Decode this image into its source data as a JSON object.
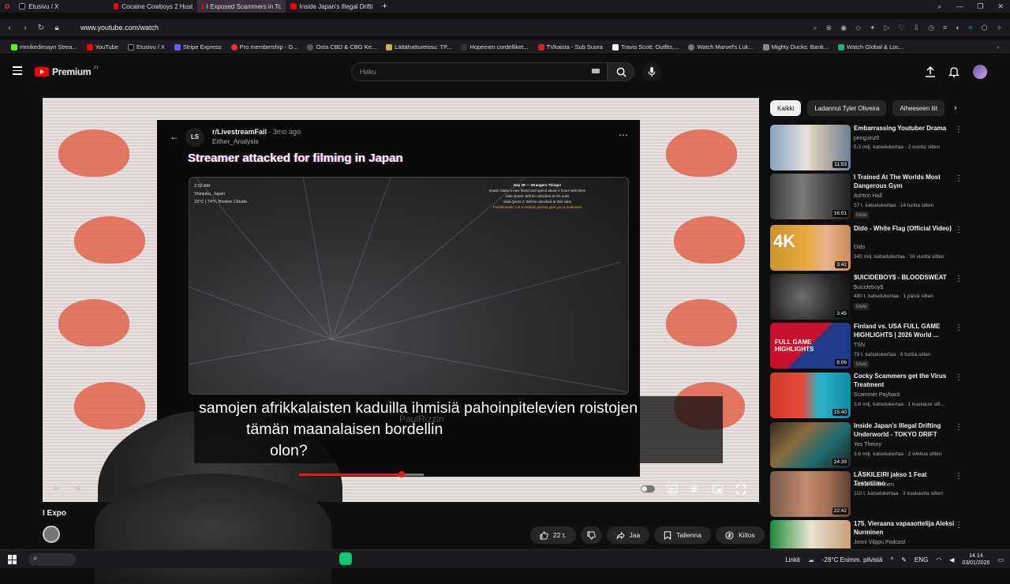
{
  "browser": {
    "tabs": [
      {
        "label": "Etusivu / X",
        "active": false
      },
      {
        "label": "Cocaine Cowboys 2 Hust",
        "active": false
      },
      {
        "label": "I Exposed Scammers in Tc",
        "active": true
      },
      {
        "label": "Inside Japan's Illegal Drifti",
        "active": false
      }
    ],
    "url": "www.youtube.com/watch",
    "bookmarks": [
      "mmikedimayn Strea...",
      "YouTube",
      "Etusivu / X",
      "Stripe Express",
      "Pro membership - G...",
      "Osta CBD & CBG Ke...",
      "Lättähattureissu: TP...",
      "Hopeinen cordelliket...",
      "TVkaista - Sub Suora",
      "Travis Scott: Outfits,...",
      "Watch Marvel's Luk...",
      "Mighty Ducks: Bank...",
      "Watch Global & Loc..."
    ]
  },
  "youtube": {
    "logo": "Premium",
    "logo_region": "FI",
    "search_placeholder": "Haku"
  },
  "player": {
    "reddit": {
      "avatar_text": "LS",
      "subreddit": "r/LivestreamFail",
      "time": " · 3mo ago",
      "user": "Either_Analysis",
      "title": "Streamer attacked for filming in Japan",
      "hud_left": [
        "2:02 AM",
        "Shinjuku, Japan",
        "23°C | 74°F, Broken Clouds"
      ],
      "hud_right": [
        "Day 29 — Strangers Things!",
        "Quest: Make a new friend and spend about 4 hours with them",
        "Side Quest: Will be unlocked at 0/1 subs",
        "Side Quest 2: Will be unlocked at 250 subs",
        "Punishments: Let a random person give you a makeover"
      ]
    },
    "subtitles": [
      "samojen afrikkalaisten kaduilla ihmisiä pahoinpitelevien roistojen",
      "tämän maanalaisen bordellin",
      "olon?"
    ],
    "ghost_text": "PaulRizzin",
    "progress_fraction": 0.82
  },
  "video": {
    "title": "I Expo",
    "actions": {
      "like": "22 t.",
      "share": "Jaa",
      "save": "Tallenna",
      "thanks": "Kiitos"
    }
  },
  "sidebar": {
    "chips": [
      "Kaikki",
      "Ladannut Tyler Oliveira",
      "Aiheeseen liit"
    ],
    "recommendations": [
      {
        "title": "Embarrassing Youtuber Drama",
        "channel": "penguinz0",
        "meta": "5,3 milj. katselukertaa · 2 vuotta sitten",
        "duration": "11:53",
        "badge": ""
      },
      {
        "title": "I Trained At The Worlds Most Dangerous Gym",
        "channel": "Ashton Hall",
        "meta": "57 t. katselukertaa · 14 tuntia sitten",
        "duration": "16:01",
        "badge": "Uusi"
      },
      {
        "title": "Dido - White Flag (Official Video)",
        "channel": "Dido",
        "meta": "340 milj. katselukertaa · 16 vuotta sitten",
        "duration": "3:42",
        "badge": ""
      },
      {
        "title": "$UICIDEBOY$ - BLOODSWEAT",
        "channel": "$uicideboy$",
        "meta": "480 t. katselukertaa · 1 päivä sitten",
        "duration": "3:45",
        "badge": "Uusi"
      },
      {
        "title": "Finland vs. USA FULL GAME HIGHLIGHTS | 2026 World ...",
        "channel": "TSN",
        "meta": "79 t. katselukertaa · 8 tuntia sitten",
        "duration": "8:06",
        "badge": "Uusi"
      },
      {
        "title": "Cocky Scammers get the Virus Treatment",
        "channel": "Scammer Payback",
        "meta": "3,8 milj. katselukertaa · 1 kuukausi sitt...",
        "duration": "15:40",
        "badge": ""
      },
      {
        "title": "Inside Japan's Illegal Drifting Underworld - TOKYO DRIFT",
        "channel": "Yes Theory",
        "meta": "3,6 milj. katselukertaa · 2 viikkoa sitten",
        "duration": "24:39",
        "badge": ""
      },
      {
        "title": "LÄSKILEIRI jakso 1 Feat Testotiimo",
        "channel": "Aleksi Nurminen",
        "meta": "110 t. katselukertaa · 3 kuukautta sitten",
        "duration": "22:42",
        "badge": ""
      },
      {
        "title": "175. Vieraana vapaaottelija Aleksi Nurminen",
        "channel": "Jenni Vilppu Podcast",
        "meta": "",
        "duration": "",
        "badge": ""
      }
    ]
  },
  "taskbar": {
    "links": "Linkit",
    "weather": "-28°C  Enimm. pilvistä",
    "lang": "ENG",
    "time": "14.14",
    "date": "03/01/2026"
  },
  "colors": {
    "accent": "#ff0000",
    "background": "#0f0f0f"
  }
}
